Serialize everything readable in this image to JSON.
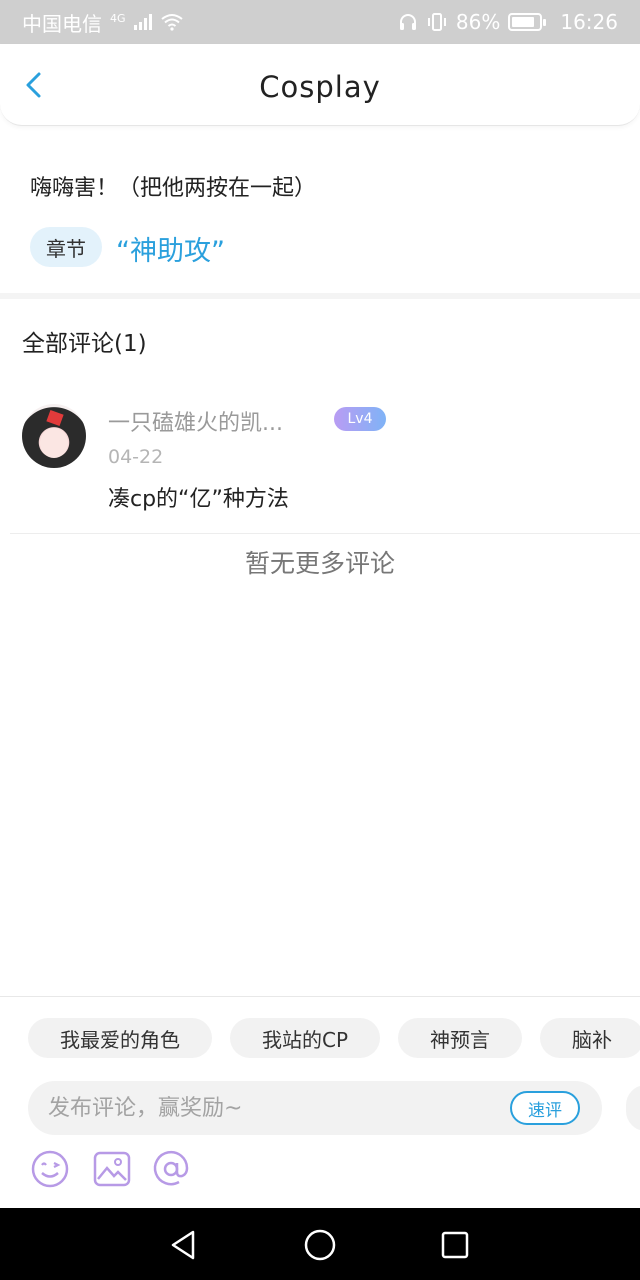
{
  "status_bar": {
    "carrier": "中国电信",
    "network": "4G",
    "battery_percent": "86%",
    "battery_level": 0.86,
    "time": "16:26"
  },
  "header": {
    "title": "Cosplay"
  },
  "post": {
    "text": "嗨嗨害！（把他两按在一起）",
    "chapter_tag": "章节",
    "chapter_name": "“神助攻”"
  },
  "comments": {
    "title": "全部评论(1)",
    "items": [
      {
        "username": "一只磕雄火的凯...",
        "level": "Lv4",
        "date": "04-22",
        "text": "凑cp的“亿”种方法"
      }
    ],
    "no_more": "暂无更多评论"
  },
  "bottom_panel": {
    "chips": [
      "我最爱的角色",
      "我站的CP",
      "神预言",
      "脑补"
    ],
    "input_placeholder": "发布评论，赢奖励~",
    "quick_label": "速评"
  },
  "colors": {
    "accent": "#2aa0dd",
    "status_bar": "#cfcfcf",
    "tool_icon": "#b79ae6"
  }
}
